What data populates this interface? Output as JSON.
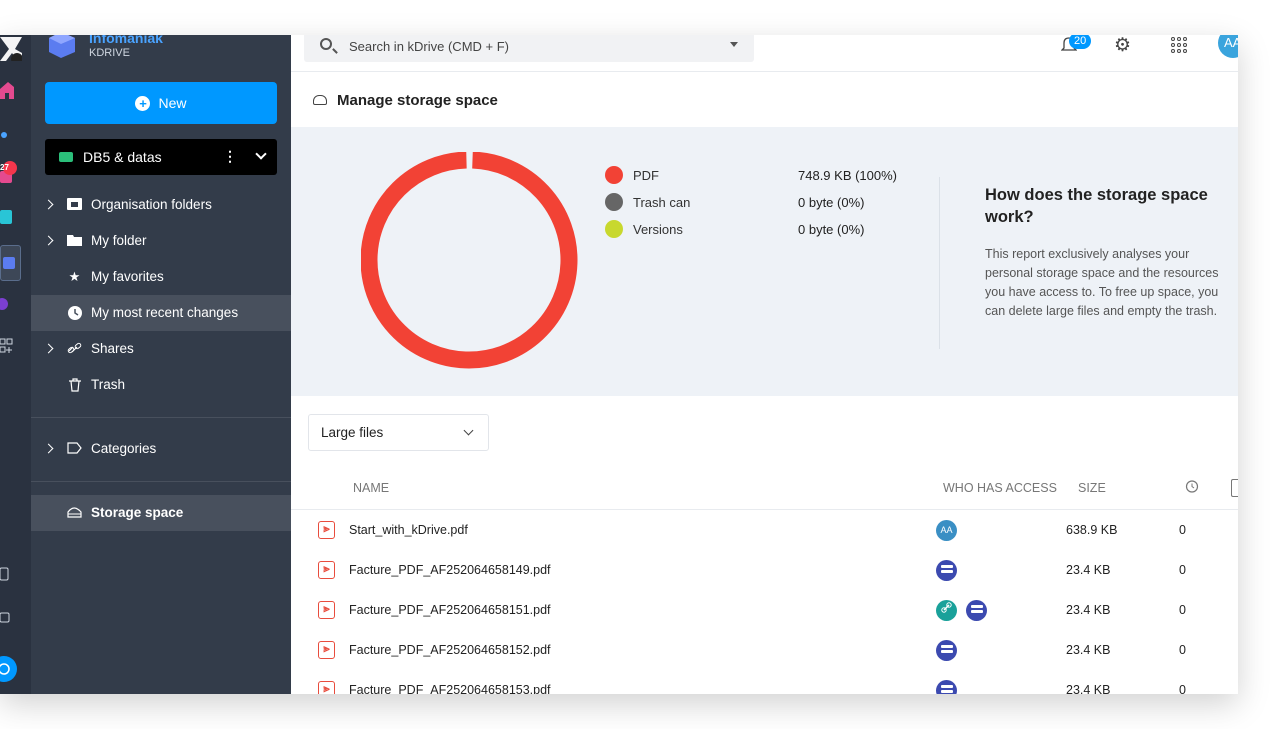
{
  "brand": {
    "name": "Infomaniak",
    "product": "KDRIVE"
  },
  "rail": {
    "badge": "27"
  },
  "sidebar": {
    "new_label": "New",
    "drive_name": "DB5 & datas",
    "items": [
      {
        "label": "Organisation folders",
        "icon": "org-folder-icon"
      },
      {
        "label": "My folder",
        "icon": "folder-icon"
      },
      {
        "label": "My favorites",
        "icon": "star-icon"
      },
      {
        "label": "My most recent changes",
        "icon": "clock-icon"
      },
      {
        "label": "Shares",
        "icon": "link-icon"
      },
      {
        "label": "Trash",
        "icon": "trash-icon"
      },
      {
        "label": "Categories",
        "icon": "tag-icon"
      },
      {
        "label": "Storage space",
        "icon": "storage-icon"
      }
    ]
  },
  "topbar": {
    "search_placeholder": "Search in kDrive (CMD + F)",
    "notifications_count": "20",
    "avatar": "AA"
  },
  "page": {
    "title": "Manage storage space"
  },
  "storage": {
    "legend": [
      {
        "label": "PDF",
        "value": "748.9 KB (100%)",
        "color": "#f24235"
      },
      {
        "label": "Trash can",
        "value": "0 byte (0%)",
        "color": "#666666"
      },
      {
        "label": "Versions",
        "value": "0 byte (0%)",
        "color": "#c8d82e"
      }
    ],
    "info_title": "How does the storage space work?",
    "info_text": "This report exclusively analyses your personal storage space and the resources you have access to. To free up space, you can delete large files and empty the trash."
  },
  "chart_data": {
    "type": "pie",
    "categories": [
      "PDF",
      "Trash can",
      "Versions"
    ],
    "values": [
      100,
      0,
      0
    ]
  },
  "files": {
    "filter": "Large files",
    "columns": {
      "name": "NAME",
      "access": "WHO HAS ACCESS",
      "size": "SIZE"
    },
    "rows": [
      {
        "name": "Start_with_kDrive.pdf",
        "size": "638.9 KB",
        "versions": "0",
        "access": [
          "AA"
        ]
      },
      {
        "name": "Facture_PDF_AF252064658149.pdf",
        "size": "23.4 KB",
        "versions": "0",
        "access": [
          "drive"
        ]
      },
      {
        "name": "Facture_PDF_AF252064658151.pdf",
        "size": "23.4 KB",
        "versions": "0",
        "access": [
          "link",
          "drive"
        ]
      },
      {
        "name": "Facture_PDF_AF252064658152.pdf",
        "size": "23.4 KB",
        "versions": "0",
        "access": [
          "drive"
        ]
      },
      {
        "name": "Facture_PDF_AF252064658153.pdf",
        "size": "23.4 KB",
        "versions": "0",
        "access": [
          "drive"
        ]
      }
    ]
  }
}
